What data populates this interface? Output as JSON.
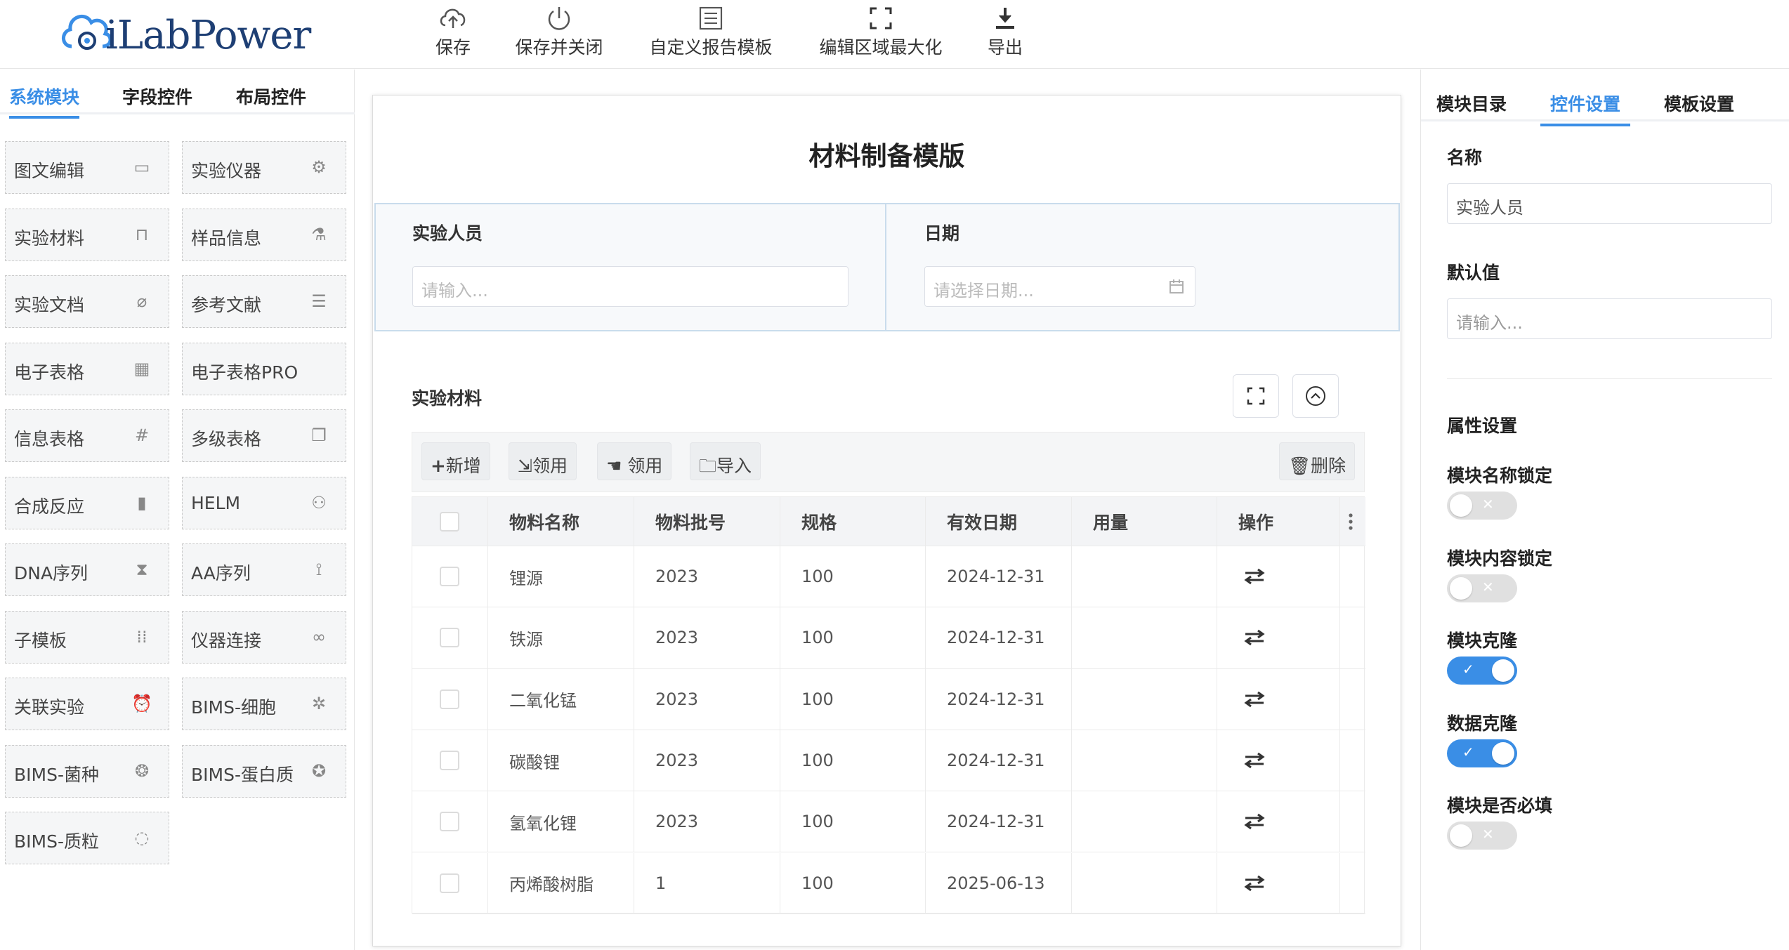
{
  "app": {
    "logo_text": "iLabPower"
  },
  "toolbar": {
    "save": "保存",
    "save_close": "保存并关闭",
    "custom_template": "自定义报告模板",
    "maximize": "编辑区域最大化",
    "export": "导出"
  },
  "left_tabs": [
    "系统模块",
    "字段控件",
    "布局控件"
  ],
  "modules": [
    {
      "label": "图文编辑",
      "icon": "text-image-icon"
    },
    {
      "label": "实验仪器",
      "icon": "instrument-icon"
    },
    {
      "label": "实验材料",
      "icon": "cup-icon"
    },
    {
      "label": "样品信息",
      "icon": "flask-icon"
    },
    {
      "label": "实验文档",
      "icon": "paperclip-icon"
    },
    {
      "label": "参考文献",
      "icon": "document-icon"
    },
    {
      "label": "电子表格",
      "icon": "calculator-icon"
    },
    {
      "label": "电子表格PRO",
      "icon": ""
    },
    {
      "label": "信息表格",
      "icon": "hash-icon"
    },
    {
      "label": "多级表格",
      "icon": "stacked-table-icon"
    },
    {
      "label": "合成反应",
      "icon": "reaction-icon"
    },
    {
      "label": "HELM",
      "icon": "helm-icon"
    },
    {
      "label": "DNA序列",
      "icon": "dna-icon"
    },
    {
      "label": "AA序列",
      "icon": "molecule-icon"
    },
    {
      "label": "子模板",
      "icon": "grid-dots-icon"
    },
    {
      "label": "仪器连接",
      "icon": "link-icon"
    },
    {
      "label": "关联实验",
      "icon": "alarm-icon"
    },
    {
      "label": "BIMS-细胞",
      "icon": "cell-icon"
    },
    {
      "label": "BIMS-菌种",
      "icon": "bacteria-icon"
    },
    {
      "label": "BIMS-蛋白质",
      "icon": "protein-icon"
    },
    {
      "label": "BIMS-质粒",
      "icon": "plasmid-icon"
    }
  ],
  "canvas": {
    "title": "材料制备模版",
    "field1": {
      "label": "实验人员",
      "placeholder": "请输入..."
    },
    "field2": {
      "label": "日期",
      "placeholder": "请选择日期..."
    },
    "section_title": "实验材料",
    "buttons": {
      "add": "新增",
      "claim1": "领用",
      "claim2": "领用",
      "import": "导入",
      "delete": "删除"
    },
    "columns": [
      "物料名称",
      "物料批号",
      "规格",
      "有效日期",
      "用量",
      "操作"
    ],
    "rows": [
      [
        "锂源",
        "2023",
        "100",
        "2024-12-31",
        ""
      ],
      [
        "铁源",
        "2023",
        "100",
        "2024-12-31",
        ""
      ],
      [
        "二氧化锰",
        "2023",
        "100",
        "2024-12-31",
        ""
      ],
      [
        "碳酸锂",
        "2023",
        "100",
        "2024-12-31",
        ""
      ],
      [
        "氢氧化锂",
        "2023",
        "100",
        "2024-12-31",
        ""
      ],
      [
        "丙烯酸树脂",
        "1",
        "100",
        "2025-06-13",
        ""
      ]
    ]
  },
  "right_tabs": [
    "模块目录",
    "控件设置",
    "模板设置"
  ],
  "settings": {
    "name_label": "名称",
    "name_value": "实验人员",
    "default_label": "默认值",
    "default_placeholder": "请输入...",
    "props_title": "属性设置",
    "toggles": [
      {
        "label": "模块名称锁定",
        "on": false
      },
      {
        "label": "模块内容锁定",
        "on": false
      },
      {
        "label": "模块克隆",
        "on": true
      },
      {
        "label": "数据克隆",
        "on": true
      },
      {
        "label": "模块是否必填",
        "on": false
      }
    ]
  },
  "colors": {
    "accent": "#3a8ee6",
    "logo": "#1e3f74"
  }
}
